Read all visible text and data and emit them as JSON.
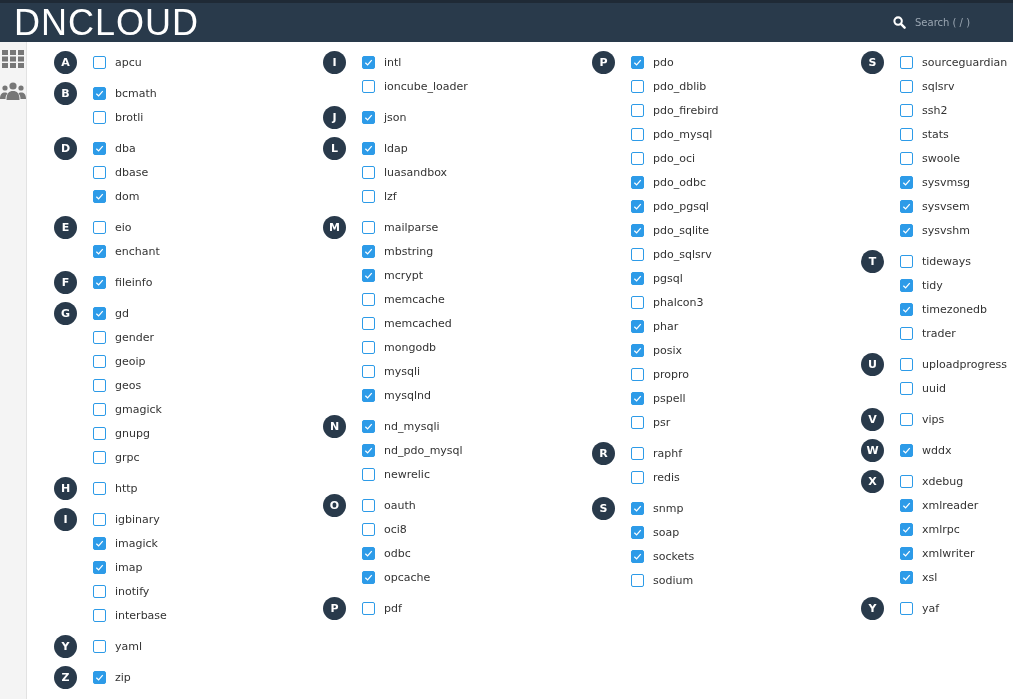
{
  "header": {
    "logo": "DNCLOUD",
    "search": {
      "placeholder": "Search ( / )"
    }
  },
  "columns": [
    {
      "groups": [
        {
          "letter": "A",
          "items": [
            {
              "name": "apcu",
              "checked": false
            }
          ]
        },
        {
          "letter": "B",
          "items": [
            {
              "name": "bcmath",
              "checked": true
            },
            {
              "name": "brotli",
              "checked": false
            }
          ]
        },
        {
          "letter": "D",
          "items": [
            {
              "name": "dba",
              "checked": true
            },
            {
              "name": "dbase",
              "checked": false
            },
            {
              "name": "dom",
              "checked": true
            }
          ]
        },
        {
          "letter": "E",
          "items": [
            {
              "name": "eio",
              "checked": false
            },
            {
              "name": "enchant",
              "checked": true
            }
          ]
        },
        {
          "letter": "F",
          "items": [
            {
              "name": "fileinfo",
              "checked": true
            }
          ]
        },
        {
          "letter": "G",
          "items": [
            {
              "name": "gd",
              "checked": true
            },
            {
              "name": "gender",
              "checked": false
            },
            {
              "name": "geoip",
              "checked": false
            },
            {
              "name": "geos",
              "checked": false
            },
            {
              "name": "gmagick",
              "checked": false
            },
            {
              "name": "gnupg",
              "checked": false
            },
            {
              "name": "grpc",
              "checked": false
            }
          ]
        },
        {
          "letter": "H",
          "items": [
            {
              "name": "http",
              "checked": false
            }
          ]
        },
        {
          "letter": "I",
          "items": [
            {
              "name": "igbinary",
              "checked": false
            },
            {
              "name": "imagick",
              "checked": true
            },
            {
              "name": "imap",
              "checked": true
            },
            {
              "name": "inotify",
              "checked": false
            },
            {
              "name": "interbase",
              "checked": false
            }
          ]
        },
        {
          "letter": "Y",
          "items": [
            {
              "name": "yaml",
              "checked": false
            }
          ]
        },
        {
          "letter": "Z",
          "items": [
            {
              "name": "zip",
              "checked": true
            }
          ]
        }
      ]
    },
    {
      "groups": [
        {
          "letter": "I",
          "items": [
            {
              "name": "intl",
              "checked": true
            },
            {
              "name": "ioncube_loader",
              "checked": false
            }
          ]
        },
        {
          "letter": "J",
          "items": [
            {
              "name": "json",
              "checked": true
            }
          ]
        },
        {
          "letter": "L",
          "items": [
            {
              "name": "ldap",
              "checked": true
            },
            {
              "name": "luasandbox",
              "checked": false
            },
            {
              "name": "lzf",
              "checked": false
            }
          ]
        },
        {
          "letter": "M",
          "items": [
            {
              "name": "mailparse",
              "checked": false
            },
            {
              "name": "mbstring",
              "checked": true
            },
            {
              "name": "mcrypt",
              "checked": true
            },
            {
              "name": "memcache",
              "checked": false
            },
            {
              "name": "memcached",
              "checked": false
            },
            {
              "name": "mongodb",
              "checked": false
            },
            {
              "name": "mysqli",
              "checked": false
            },
            {
              "name": "mysqlnd",
              "checked": true
            }
          ]
        },
        {
          "letter": "N",
          "items": [
            {
              "name": "nd_mysqli",
              "checked": true
            },
            {
              "name": "nd_pdo_mysql",
              "checked": true
            },
            {
              "name": "newrelic",
              "checked": false
            }
          ]
        },
        {
          "letter": "O",
          "items": [
            {
              "name": "oauth",
              "checked": false
            },
            {
              "name": "oci8",
              "checked": false
            },
            {
              "name": "odbc",
              "checked": true
            },
            {
              "name": "opcache",
              "checked": true
            }
          ]
        },
        {
          "letter": "P",
          "items": [
            {
              "name": "pdf",
              "checked": false
            }
          ]
        }
      ]
    },
    {
      "groups": [
        {
          "letter": "P",
          "items": [
            {
              "name": "pdo",
              "checked": true
            },
            {
              "name": "pdo_dblib",
              "checked": false
            },
            {
              "name": "pdo_firebird",
              "checked": false
            },
            {
              "name": "pdo_mysql",
              "checked": false
            },
            {
              "name": "pdo_oci",
              "checked": false
            },
            {
              "name": "pdo_odbc",
              "checked": true
            },
            {
              "name": "pdo_pgsql",
              "checked": true
            },
            {
              "name": "pdo_sqlite",
              "checked": true
            },
            {
              "name": "pdo_sqlsrv",
              "checked": false
            },
            {
              "name": "pgsql",
              "checked": true
            },
            {
              "name": "phalcon3",
              "checked": false
            },
            {
              "name": "phar",
              "checked": true
            },
            {
              "name": "posix",
              "checked": true
            },
            {
              "name": "propro",
              "checked": false
            },
            {
              "name": "pspell",
              "checked": true
            },
            {
              "name": "psr",
              "checked": false
            }
          ]
        },
        {
          "letter": "R",
          "items": [
            {
              "name": "raphf",
              "checked": false
            },
            {
              "name": "redis",
              "checked": false
            }
          ]
        },
        {
          "letter": "S",
          "items": [
            {
              "name": "snmp",
              "checked": true
            },
            {
              "name": "soap",
              "checked": true
            },
            {
              "name": "sockets",
              "checked": true
            },
            {
              "name": "sodium",
              "checked": false
            }
          ]
        }
      ]
    },
    {
      "groups": [
        {
          "letter": "S",
          "items": [
            {
              "name": "sourceguardian",
              "checked": false
            },
            {
              "name": "sqlsrv",
              "checked": false
            },
            {
              "name": "ssh2",
              "checked": false
            },
            {
              "name": "stats",
              "checked": false
            },
            {
              "name": "swoole",
              "checked": false
            },
            {
              "name": "sysvmsg",
              "checked": true
            },
            {
              "name": "sysvsem",
              "checked": true
            },
            {
              "name": "sysvshm",
              "checked": true
            }
          ]
        },
        {
          "letter": "T",
          "items": [
            {
              "name": "tideways",
              "checked": false
            },
            {
              "name": "tidy",
              "checked": true
            },
            {
              "name": "timezonedb",
              "checked": true
            },
            {
              "name": "trader",
              "checked": false
            }
          ]
        },
        {
          "letter": "U",
          "items": [
            {
              "name": "uploadprogress",
              "checked": false
            },
            {
              "name": "uuid",
              "checked": false
            }
          ]
        },
        {
          "letter": "V",
          "items": [
            {
              "name": "vips",
              "checked": false
            }
          ]
        },
        {
          "letter": "W",
          "items": [
            {
              "name": "wddx",
              "checked": true
            }
          ]
        },
        {
          "letter": "X",
          "items": [
            {
              "name": "xdebug",
              "checked": false
            },
            {
              "name": "xmlreader",
              "checked": true
            },
            {
              "name": "xmlrpc",
              "checked": true
            },
            {
              "name": "xmlwriter",
              "checked": true
            },
            {
              "name": "xsl",
              "checked": true
            }
          ]
        },
        {
          "letter": "Y",
          "items": [
            {
              "name": "yaf",
              "checked": false
            }
          ]
        }
      ]
    }
  ]
}
